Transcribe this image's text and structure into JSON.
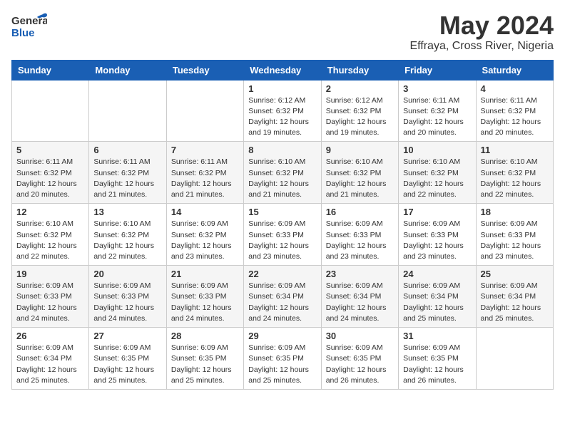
{
  "header": {
    "logo_general": "General",
    "logo_blue": "Blue",
    "month_title": "May 2024",
    "location": "Effraya, Cross River, Nigeria"
  },
  "days_of_week": [
    "Sunday",
    "Monday",
    "Tuesday",
    "Wednesday",
    "Thursday",
    "Friday",
    "Saturday"
  ],
  "weeks": [
    [
      {
        "day": "",
        "info": ""
      },
      {
        "day": "",
        "info": ""
      },
      {
        "day": "",
        "info": ""
      },
      {
        "day": "1",
        "info": "Sunrise: 6:12 AM\nSunset: 6:32 PM\nDaylight: 12 hours\nand 19 minutes."
      },
      {
        "day": "2",
        "info": "Sunrise: 6:12 AM\nSunset: 6:32 PM\nDaylight: 12 hours\nand 19 minutes."
      },
      {
        "day": "3",
        "info": "Sunrise: 6:11 AM\nSunset: 6:32 PM\nDaylight: 12 hours\nand 20 minutes."
      },
      {
        "day": "4",
        "info": "Sunrise: 6:11 AM\nSunset: 6:32 PM\nDaylight: 12 hours\nand 20 minutes."
      }
    ],
    [
      {
        "day": "5",
        "info": "Sunrise: 6:11 AM\nSunset: 6:32 PM\nDaylight: 12 hours\nand 20 minutes."
      },
      {
        "day": "6",
        "info": "Sunrise: 6:11 AM\nSunset: 6:32 PM\nDaylight: 12 hours\nand 21 minutes."
      },
      {
        "day": "7",
        "info": "Sunrise: 6:11 AM\nSunset: 6:32 PM\nDaylight: 12 hours\nand 21 minutes."
      },
      {
        "day": "8",
        "info": "Sunrise: 6:10 AM\nSunset: 6:32 PM\nDaylight: 12 hours\nand 21 minutes."
      },
      {
        "day": "9",
        "info": "Sunrise: 6:10 AM\nSunset: 6:32 PM\nDaylight: 12 hours\nand 21 minutes."
      },
      {
        "day": "10",
        "info": "Sunrise: 6:10 AM\nSunset: 6:32 PM\nDaylight: 12 hours\nand 22 minutes."
      },
      {
        "day": "11",
        "info": "Sunrise: 6:10 AM\nSunset: 6:32 PM\nDaylight: 12 hours\nand 22 minutes."
      }
    ],
    [
      {
        "day": "12",
        "info": "Sunrise: 6:10 AM\nSunset: 6:32 PM\nDaylight: 12 hours\nand 22 minutes."
      },
      {
        "day": "13",
        "info": "Sunrise: 6:10 AM\nSunset: 6:32 PM\nDaylight: 12 hours\nand 22 minutes."
      },
      {
        "day": "14",
        "info": "Sunrise: 6:09 AM\nSunset: 6:32 PM\nDaylight: 12 hours\nand 23 minutes."
      },
      {
        "day": "15",
        "info": "Sunrise: 6:09 AM\nSunset: 6:33 PM\nDaylight: 12 hours\nand 23 minutes."
      },
      {
        "day": "16",
        "info": "Sunrise: 6:09 AM\nSunset: 6:33 PM\nDaylight: 12 hours\nand 23 minutes."
      },
      {
        "day": "17",
        "info": "Sunrise: 6:09 AM\nSunset: 6:33 PM\nDaylight: 12 hours\nand 23 minutes."
      },
      {
        "day": "18",
        "info": "Sunrise: 6:09 AM\nSunset: 6:33 PM\nDaylight: 12 hours\nand 23 minutes."
      }
    ],
    [
      {
        "day": "19",
        "info": "Sunrise: 6:09 AM\nSunset: 6:33 PM\nDaylight: 12 hours\nand 24 minutes."
      },
      {
        "day": "20",
        "info": "Sunrise: 6:09 AM\nSunset: 6:33 PM\nDaylight: 12 hours\nand 24 minutes."
      },
      {
        "day": "21",
        "info": "Sunrise: 6:09 AM\nSunset: 6:33 PM\nDaylight: 12 hours\nand 24 minutes."
      },
      {
        "day": "22",
        "info": "Sunrise: 6:09 AM\nSunset: 6:34 PM\nDaylight: 12 hours\nand 24 minutes."
      },
      {
        "day": "23",
        "info": "Sunrise: 6:09 AM\nSunset: 6:34 PM\nDaylight: 12 hours\nand 24 minutes."
      },
      {
        "day": "24",
        "info": "Sunrise: 6:09 AM\nSunset: 6:34 PM\nDaylight: 12 hours\nand 25 minutes."
      },
      {
        "day": "25",
        "info": "Sunrise: 6:09 AM\nSunset: 6:34 PM\nDaylight: 12 hours\nand 25 minutes."
      }
    ],
    [
      {
        "day": "26",
        "info": "Sunrise: 6:09 AM\nSunset: 6:34 PM\nDaylight: 12 hours\nand 25 minutes."
      },
      {
        "day": "27",
        "info": "Sunrise: 6:09 AM\nSunset: 6:35 PM\nDaylight: 12 hours\nand 25 minutes."
      },
      {
        "day": "28",
        "info": "Sunrise: 6:09 AM\nSunset: 6:35 PM\nDaylight: 12 hours\nand 25 minutes."
      },
      {
        "day": "29",
        "info": "Sunrise: 6:09 AM\nSunset: 6:35 PM\nDaylight: 12 hours\nand 25 minutes."
      },
      {
        "day": "30",
        "info": "Sunrise: 6:09 AM\nSunset: 6:35 PM\nDaylight: 12 hours\nand 26 minutes."
      },
      {
        "day": "31",
        "info": "Sunrise: 6:09 AM\nSunset: 6:35 PM\nDaylight: 12 hours\nand 26 minutes."
      },
      {
        "day": "",
        "info": ""
      }
    ]
  ]
}
